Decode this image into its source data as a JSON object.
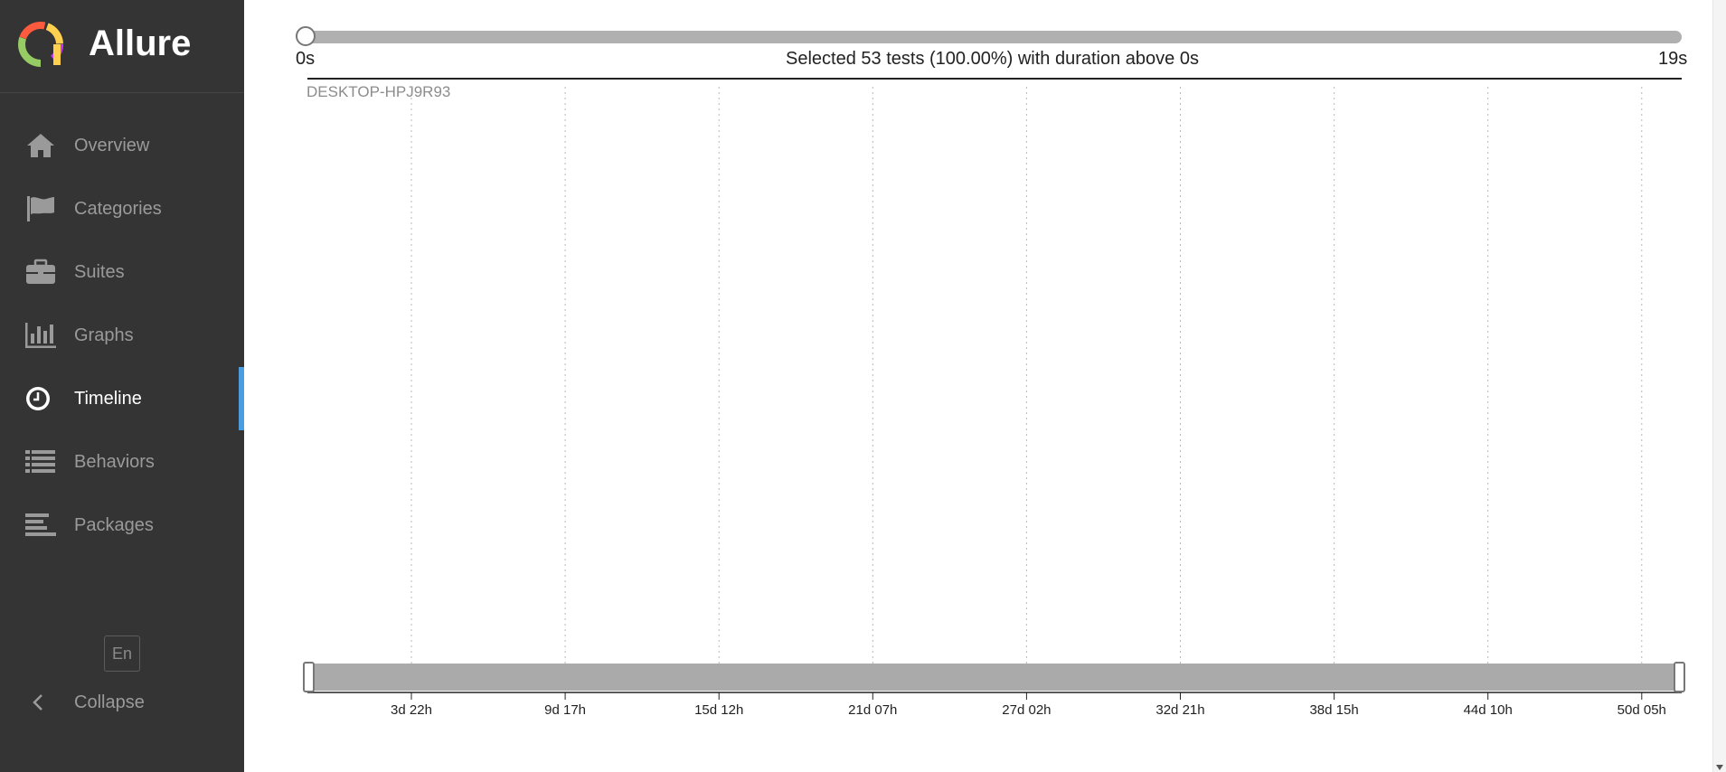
{
  "app": {
    "title": "Allure"
  },
  "colors": {
    "sidebar_bg": "#343434",
    "active_indicator": "#4a9ee0",
    "logo_ring": [
      "#97cc64",
      "#fd5a3e",
      "#ffd050",
      "#c3f",
      "#aaa"
    ]
  },
  "sidebar": {
    "items": [
      {
        "label": "Overview",
        "icon": "home-icon",
        "active": false
      },
      {
        "label": "Categories",
        "icon": "flag-icon",
        "active": false
      },
      {
        "label": "Suites",
        "icon": "briefcase-icon",
        "active": false
      },
      {
        "label": "Graphs",
        "icon": "bar-chart-icon",
        "active": false
      },
      {
        "label": "Timeline",
        "icon": "clock-icon",
        "active": true
      },
      {
        "label": "Behaviors",
        "icon": "list-icon",
        "active": false
      },
      {
        "label": "Packages",
        "icon": "align-left-icon",
        "active": false
      }
    ],
    "language": "En",
    "collapse_label": "Collapse"
  },
  "duration_filter": {
    "min_label": "0s",
    "max_label": "19s",
    "summary": "Selected 53 tests (100.00%) with duration above 0s",
    "selected_fraction": 0.0
  },
  "timeline": {
    "host": "DESKTOP-HPJ9R93",
    "ticks": [
      "3d 22h",
      "9d 17h",
      "15d 12h",
      "21d 07h",
      "27d 02h",
      "32d 21h",
      "38d 15h",
      "44d 10h",
      "50d 05h"
    ]
  }
}
